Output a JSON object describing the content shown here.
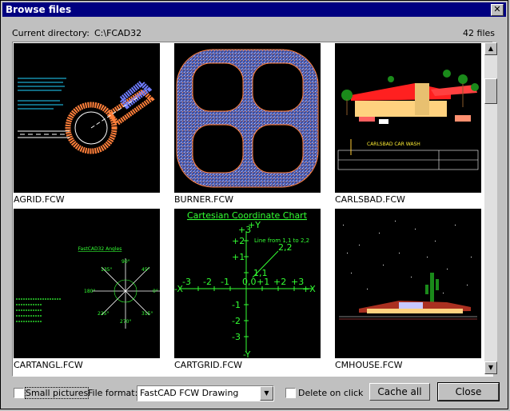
{
  "window": {
    "title": "Browse files",
    "close_glyph": "✕"
  },
  "directory": {
    "label": "Current directory:",
    "value": "C:\\FCAD32",
    "count": "42 files"
  },
  "files": [
    {
      "name": "AGRID.FCW"
    },
    {
      "name": "BURNER.FCW"
    },
    {
      "name": "CARLSBAD.FCW"
    },
    {
      "name": "CARTANGL.FCW"
    },
    {
      "name": "CARTGRID.FCW"
    },
    {
      "name": "CMHOUSE.FCW"
    }
  ],
  "thumb_text": {
    "cartgrid_title": "Cartesian Coordinate Chart",
    "cartgrid_note": "Line from 1,1 to 2,2",
    "cartangl_title": "FastCAD32 Angles",
    "carlsbad_sign": "CARLSBAD CAR WASH"
  },
  "controls": {
    "small_pictures": "Small pictures",
    "file_format_label": "File format:",
    "file_format_value": "FastCAD FCW Drawing",
    "delete_on_click": "Delete on click",
    "cache_all": "Cache all",
    "close": "Close"
  },
  "scrollbar": {
    "up_glyph": "▲",
    "down_glyph": "▼"
  },
  "colors": {
    "titlebar": "#000080",
    "face": "#c0c0c0"
  }
}
